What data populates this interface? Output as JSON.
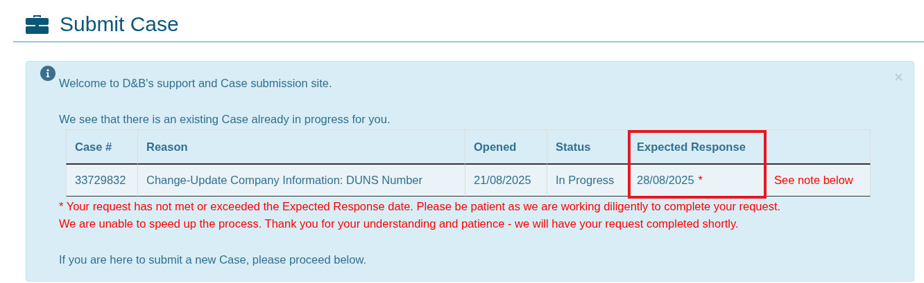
{
  "page": {
    "title": "Submit Case"
  },
  "alert": {
    "welcome": "Welcome to D&B's support and Case submission site.",
    "existing": "We see that there is an existing Case already in progress for you.",
    "table": {
      "columns": [
        {
          "label": "Case #",
          "highlighted": false
        },
        {
          "label": "Reason",
          "highlighted": false
        },
        {
          "label": "Opened",
          "highlighted": false
        },
        {
          "label": "Status",
          "highlighted": false
        },
        {
          "label": "Expected Response",
          "highlighted": true
        }
      ],
      "rows": [
        {
          "case": "33729832",
          "reason": "Change-Update Company Information: DUNS Number",
          "opened": "21/08/2025",
          "status": "In Progress",
          "expected_response": "28/08/2025",
          "marker": "*",
          "note": "See note below"
        }
      ]
    },
    "notes": [
      "* Your request has not met or exceeded the Expected Response date. Please be patient as we are working diligently to complete your request.",
      "We are unable to speed up the process. Thank you for your understanding and patience - we will have your request completed shortly."
    ],
    "closing": "If you are here to submit a new Case, please proceed below."
  }
}
